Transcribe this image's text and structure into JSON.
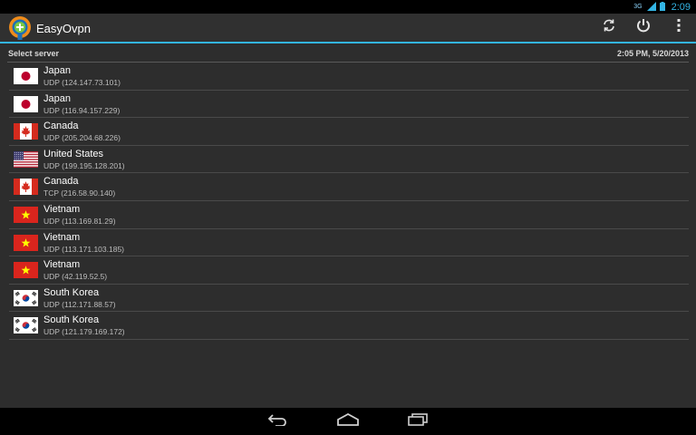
{
  "status_bar": {
    "signal_label": "3G",
    "time": "2:09"
  },
  "action_bar": {
    "title": "EasyOvpn",
    "actions": [
      "refresh-icon",
      "power-icon",
      "overflow-menu-icon"
    ]
  },
  "subheader": {
    "label": "Select server",
    "timestamp": "2:05 PM, 5/20/2013"
  },
  "servers": [
    {
      "country": "Japan",
      "address": "UDP (124.147.73.101)",
      "flag": "jp"
    },
    {
      "country": "Japan",
      "address": "UDP (116.94.157.229)",
      "flag": "jp"
    },
    {
      "country": "Canada",
      "address": "UDP (205.204.68.226)",
      "flag": "ca"
    },
    {
      "country": "United States",
      "address": "UDP (199.195.128.201)",
      "flag": "us"
    },
    {
      "country": "Canada",
      "address": "TCP (216.58.90.140)",
      "flag": "ca"
    },
    {
      "country": "Vietnam",
      "address": "UDP (113.169.81.29)",
      "flag": "vn"
    },
    {
      "country": "Vietnam",
      "address": "UDP (113.171.103.185)",
      "flag": "vn"
    },
    {
      "country": "Vietnam",
      "address": "UDP (42.119.52.5)",
      "flag": "vn"
    },
    {
      "country": "South Korea",
      "address": "UDP (112.171.88.57)",
      "flag": "kr"
    },
    {
      "country": "South Korea",
      "address": "UDP (121.179.169.172)",
      "flag": "kr"
    }
  ],
  "colors": {
    "accent": "#33b5e5",
    "background": "#2d2d2d",
    "action_bar": "#303030"
  }
}
